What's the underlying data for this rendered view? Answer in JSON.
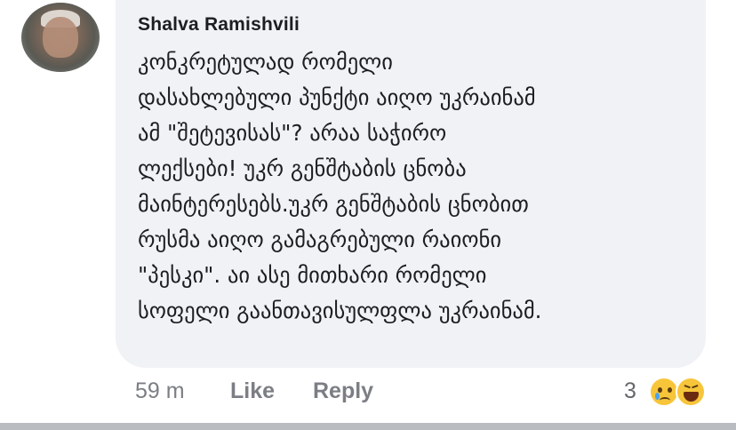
{
  "comment": {
    "author": "Shalva Ramishvili",
    "lines": [
      "კონკრეტულად რომელი",
      "დასახლებული პუნქტი აიღო უკრაინამ",
      "ამ \"შეტევისას\"? არაა საჭირო",
      "ლექსები! უკრ გენშტაბის ცნობა",
      "მაინტერესებს.უკრ გენშტაბის ცნობით",
      "რუსმა აიღო გამაგრებული რაიონი",
      "\"პესკი\". აი ასე მითხარი რომელი",
      "სოფელი გაანთავისულფლა უკრაინამ."
    ],
    "timestamp": "59 m",
    "like_label": "Like",
    "reply_label": "Reply",
    "reaction_count": "3",
    "reactions": [
      "sad-icon",
      "haha-icon"
    ]
  },
  "colors": {
    "bubble_bg": "#f0f2f5",
    "author_text": "#1c1e21",
    "meta_text": "#7b7e84",
    "reaction_yellow": "#f7c53a"
  }
}
